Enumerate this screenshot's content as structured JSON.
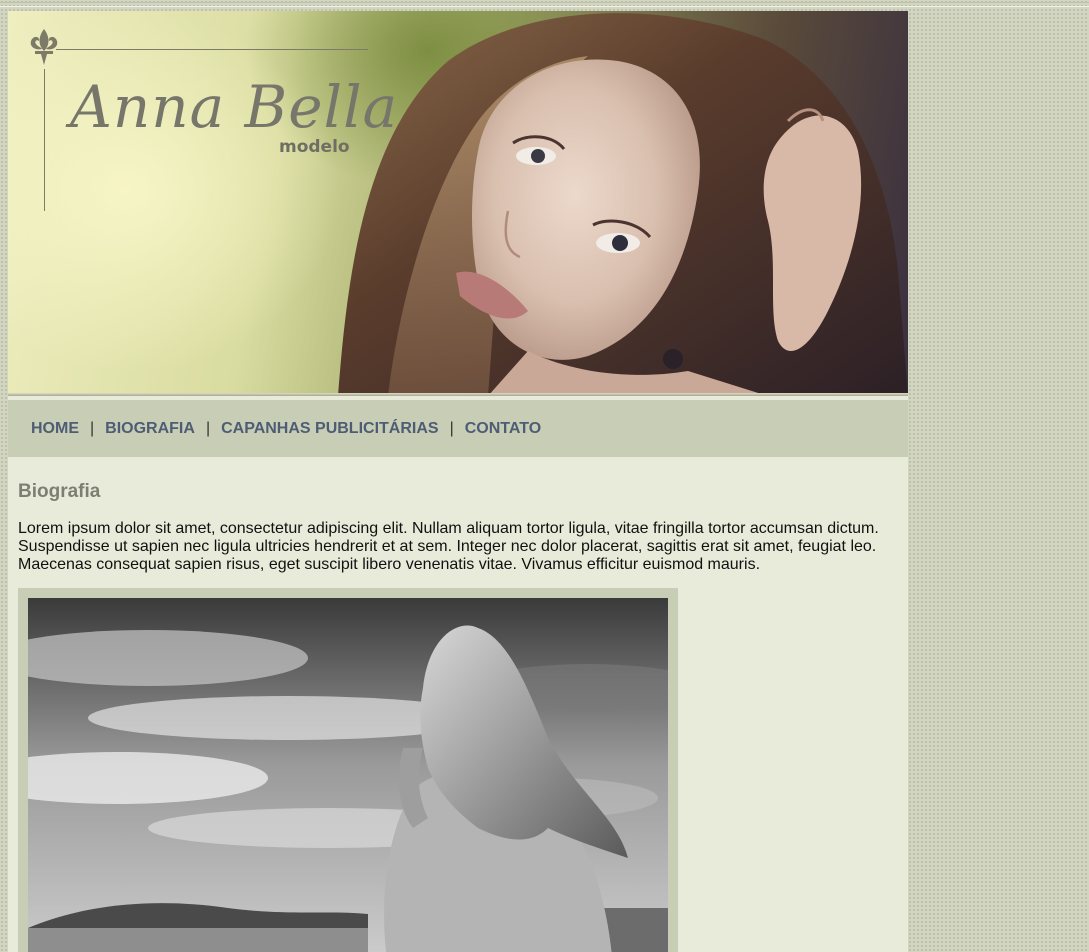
{
  "header": {
    "logo_name": "Anna Bella",
    "logo_sub": "modelo"
  },
  "nav": {
    "items": [
      {
        "label": "HOME"
      },
      {
        "label": "BIOGRAFIA"
      },
      {
        "label": "CAPANHAS PUBLICITÁRIAS"
      },
      {
        "label": "CONTATO"
      }
    ],
    "separator": "|"
  },
  "content": {
    "title": "Biografia",
    "paragraph": "Lorem ipsum dolor sit amet, consectetur adipiscing elit. Nullam aliquam tortor ligula, vitae fringilla tortor accumsan dictum. Suspendisse ut sapien nec ligula ultricies hendrerit et at sem. Integer nec dolor placerat, sagittis erat sit amet, feugiat leo. Maecenas consequat sapien risus, eget suscipit libero venenatis vitae. Vivamus efficitur euismod mauris."
  },
  "colors": {
    "page_bg": "#e8ebda",
    "nav_bg": "#c8cdb6",
    "nav_link": "#4e5d74",
    "heading": "#7d8070",
    "logo": "#77766a"
  },
  "icons": {
    "logo_ornament": "fleur-de-lis-icon"
  }
}
